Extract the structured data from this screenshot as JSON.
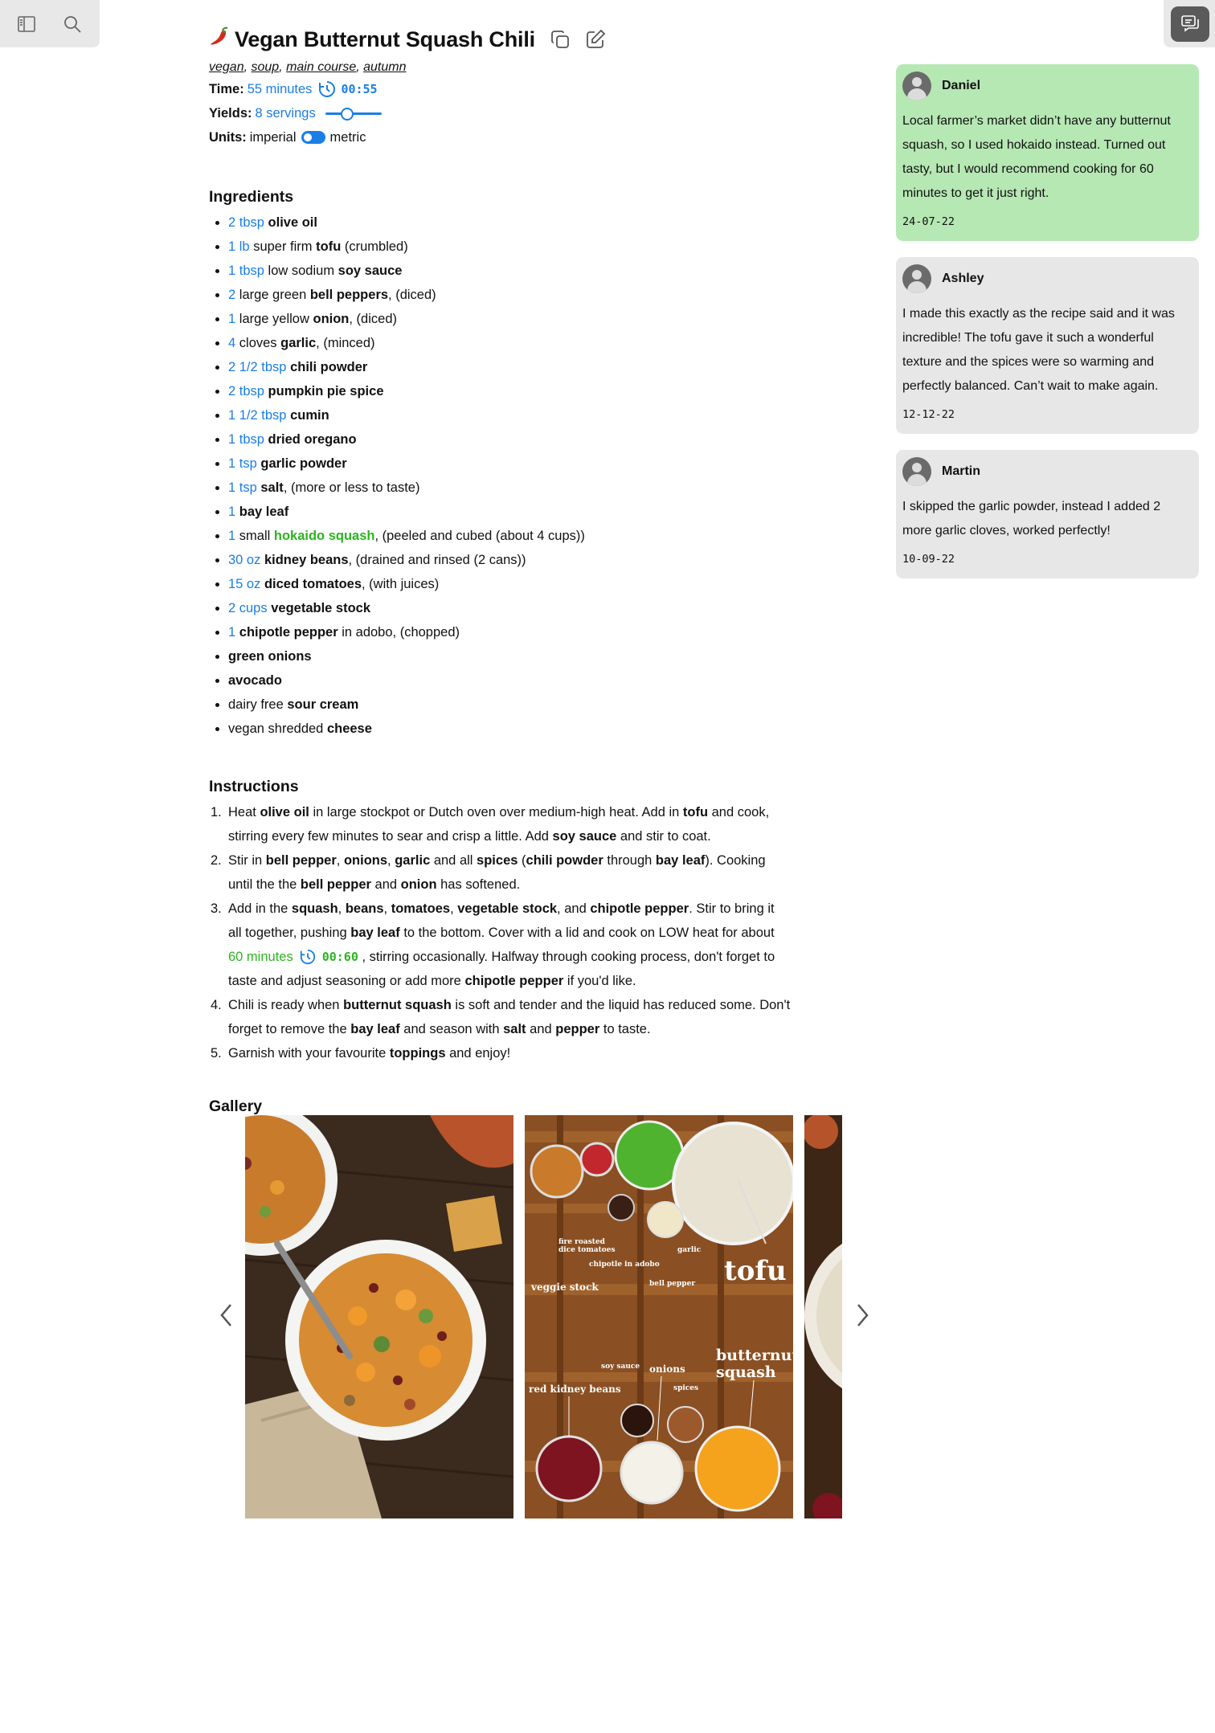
{
  "toolbar": {
    "sidebar_icon": "sidebar-icon",
    "search_icon": "search-icon",
    "comments_icon": "comments-icon"
  },
  "recipe": {
    "emoji": "🌶️",
    "title": "Vegan Butternut Squash Chili",
    "tags": [
      "vegan",
      "soup",
      "main course",
      "autumn"
    ],
    "time_label": "Time:",
    "time_value": "55 minutes",
    "time_timer": "00:55",
    "yields_label": "Yields:",
    "yields_value": "8 servings",
    "yields_slider_fraction": 0.35,
    "units_label": "Units:",
    "units_left": "imperial",
    "units_right": "metric"
  },
  "ingredients": {
    "heading": "Ingredients",
    "items": [
      {
        "qty": "2 tbsp",
        "pre": " ",
        "name": "olive oil",
        "post": ""
      },
      {
        "qty": "1 lb",
        "pre": " super firm ",
        "name": "tofu",
        "post": " (crumbled)"
      },
      {
        "qty": "1 tbsp",
        "pre": " low sodium ",
        "name": "soy sauce",
        "post": ""
      },
      {
        "qty": "2",
        "pre": " large green ",
        "name": "bell peppers",
        "post": ", (diced)"
      },
      {
        "qty": "1",
        "pre": " large yellow ",
        "name": "onion",
        "post": ", (diced)"
      },
      {
        "qty": "4",
        "pre": " cloves ",
        "name": "garlic",
        "post": ", (minced)"
      },
      {
        "qty": "2 1/2 tbsp",
        "pre": " ",
        "name": "chili powder",
        "post": ""
      },
      {
        "qty": "2 tbsp",
        "pre": " ",
        "name": "pumpkin pie spice",
        "post": ""
      },
      {
        "qty": "1 1/2 tbsp",
        "pre": " ",
        "name": "cumin",
        "post": ""
      },
      {
        "qty": "1 tbsp",
        "pre": " ",
        "name": "dried oregano",
        "post": ""
      },
      {
        "qty": "1 tsp",
        "pre": " ",
        "name": "garlic powder",
        "post": ""
      },
      {
        "qty": "1 tsp",
        "pre": " ",
        "name": "salt",
        "post": ", (more or less to taste)"
      },
      {
        "qty": "1",
        "pre": " ",
        "name": "bay leaf",
        "post": ""
      },
      {
        "qty": "1",
        "pre": " small ",
        "name": "hokaido squash",
        "post": ", (peeled and cubed (about 4 cups))",
        "name_green": true
      },
      {
        "qty": "30 oz",
        "pre": " ",
        "name": "kidney beans",
        "post": ", (drained and rinsed (2 cans))"
      },
      {
        "qty": "15 oz",
        "pre": " ",
        "name": "diced tomatoes",
        "post": ", (with juices)"
      },
      {
        "qty": "2 cups",
        "pre": " ",
        "name": "vegetable stock",
        "post": ""
      },
      {
        "qty": "1",
        "pre": " ",
        "name": "chipotle pepper",
        "post": " in adobo, (chopped)"
      },
      {
        "qty": "",
        "pre": "",
        "name": "green onions",
        "post": ""
      },
      {
        "qty": "",
        "pre": "",
        "name": "avocado",
        "post": ""
      },
      {
        "qty": "",
        "pre": "dairy free ",
        "name": "sour cream",
        "post": ""
      },
      {
        "qty": "",
        "pre": "vegan shredded ",
        "name": "cheese",
        "post": ""
      }
    ]
  },
  "instructions": {
    "heading": "Instructions",
    "steps": [
      [
        {
          "t": "Heat "
        },
        {
          "b": "olive oil"
        },
        {
          "t": " in large stockpot or Dutch oven over medium-high heat. Add in "
        },
        {
          "b": "tofu"
        },
        {
          "t": "  and cook, stirring every few minutes to sear and crisp a little. Add "
        },
        {
          "b": "soy sauce"
        },
        {
          "t": " and stir to coat."
        }
      ],
      [
        {
          "t": "Stir in "
        },
        {
          "b": "bell pepper"
        },
        {
          "t": ", "
        },
        {
          "b": "onions"
        },
        {
          "t": ", "
        },
        {
          "b": "garlic"
        },
        {
          "t": " and all "
        },
        {
          "b": "spices"
        },
        {
          "t": " ("
        },
        {
          "b": "chili powder"
        },
        {
          "t": " through "
        },
        {
          "b": "bay leaf"
        },
        {
          "t": "). Cooking until the the "
        },
        {
          "b": "bell pepper"
        },
        {
          "t": " and "
        },
        {
          "b": "onion"
        },
        {
          "t": " has softened."
        }
      ],
      [
        {
          "t": "Add in the "
        },
        {
          "b": "squash"
        },
        {
          "t": ", "
        },
        {
          "b": "beans"
        },
        {
          "t": ", "
        },
        {
          "b": "tomatoes"
        },
        {
          "t": ", "
        },
        {
          "b": "vegetable stock"
        },
        {
          "t": ", and "
        },
        {
          "b": "chipotle pepper"
        },
        {
          "t": ". Stir to bring it all together, pushing "
        },
        {
          "b": "bay leaf"
        },
        {
          "t": " to the bottom. Cover with a lid and cook on LOW heat for about "
        },
        {
          "g": "60 minutes"
        },
        {
          "timer": "00:60"
        },
        {
          "t": " , stirring occasionally. Halfway through cooking process, don't forget to taste and adjust seasoning or add more "
        },
        {
          "b": "chipotle pepper"
        },
        {
          "t": " if you'd like."
        }
      ],
      [
        {
          "t": "Chili is ready when "
        },
        {
          "b": "butternut squash"
        },
        {
          "t": " is soft and tender and the liquid has reduced some. Don't forget to remove the "
        },
        {
          "b": "bay leaf"
        },
        {
          "t": " and season with "
        },
        {
          "b": "salt"
        },
        {
          "t": " and "
        },
        {
          "b": "pepper"
        },
        {
          "t": " to taste."
        }
      ],
      [
        {
          "t": "Garnish with your favourite "
        },
        {
          "b": "toppings"
        },
        {
          "t": " and enjoy!"
        }
      ]
    ]
  },
  "gallery": {
    "heading": "Gallery",
    "prev_icon": "chevron-left-icon",
    "next_icon": "chevron-right-icon",
    "labels": {
      "fire_roasted": "fire roasted",
      "dice_tomatoes": "dice tomatoes",
      "chipotle": "chipotle in adobo",
      "garlic": "garlic",
      "tofu": "tofu",
      "veggie_stock": "veggie stock",
      "bell_pepper": "bell pepper",
      "soy_sauce": "soy sauce",
      "onions": "onions",
      "butternut": "butternut",
      "squash": "squash",
      "red_kidney_beans": "red kidney beans",
      "spices": "spices"
    }
  },
  "comments": [
    {
      "name": "Daniel",
      "text": "Local farmer’s market didn’t have any butternut squash, so I used hokaido instead. Turned out tasty, but I would recommend cooking for 60 minutes to get it just right.",
      "date": "24-07-22",
      "highlight": true
    },
    {
      "name": "Ashley",
      "text": "I made this exactly as the recipe said and it was incredible! The tofu gave it such a wonderful texture and the spices were so warming and perfectly balanced. Can’t wait to make again.",
      "date": "12-12-22",
      "highlight": false
    },
    {
      "name": "Martin",
      "text": "I skipped the garlic powder, instead I added 2 more garlic cloves, worked perfectly!",
      "date": "10-09-22",
      "highlight": false
    }
  ]
}
